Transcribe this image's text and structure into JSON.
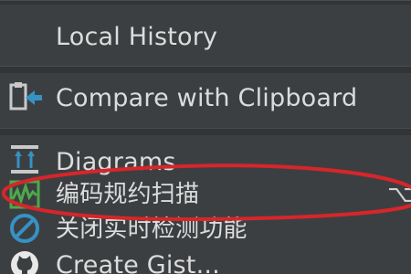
{
  "menu": {
    "items": [
      {
        "label": "Local History",
        "icon": "none"
      },
      {
        "label": "Compare with Clipboard",
        "icon": "compare-clipboard-icon"
      },
      {
        "label": "Diagrams",
        "icon": "diagrams-icon"
      },
      {
        "label": "编码规约扫描",
        "icon": "code-scan-icon",
        "shortcut": "⌥"
      },
      {
        "label": "关闭实时检测功能",
        "icon": "disable-icon"
      },
      {
        "label": "Create Gist...",
        "icon": "github-icon"
      }
    ]
  },
  "colors": {
    "background": "#3c3f41",
    "separator": "#323435",
    "text": "#dcdcdc",
    "annotation": "#d6262b",
    "accent_blue": "#3592c4",
    "accent_green": "#4ea94a"
  }
}
